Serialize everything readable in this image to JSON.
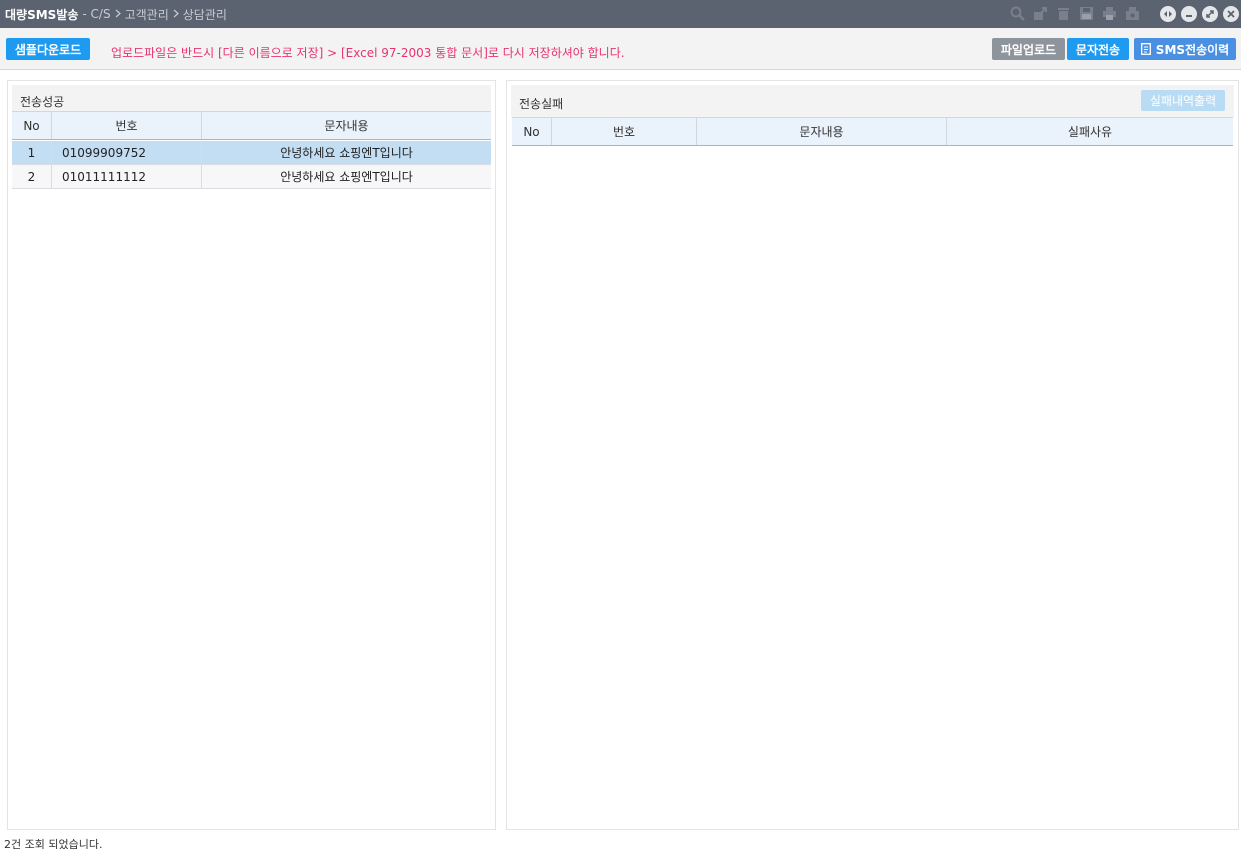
{
  "titlebar": {
    "title": "대량SMS발송",
    "crumb_lead": "- C/S",
    "crumb_1": "고객관리",
    "crumb_2": "상담관리"
  },
  "toolbar": {
    "sample_download": "샘플다운로드",
    "notice": "업로드파일은 반드시 [다른 이름으로 저장] > [Excel 97-2003 통합 문서]로 다시 저장하셔야 합니다.",
    "file_upload": "파일업로드",
    "send_message": "문자전송",
    "sms_history": "SMS전송이력"
  },
  "success_panel": {
    "title": "전송성공",
    "columns": [
      "No",
      "번호",
      "문자내용"
    ],
    "rows": [
      {
        "no": "1",
        "number": "01099909752",
        "content": "안녕하세요 쇼핑엔T입니다"
      },
      {
        "no": "2",
        "number": "01011111112",
        "content": "안녕하세요 쇼핑엔T입니다"
      }
    ]
  },
  "failure_panel": {
    "title": "전송실패",
    "export_button": "실패내역출력",
    "columns": [
      "No",
      "번호",
      "문자내용",
      "실패사유"
    ]
  },
  "status_text": "2건 조회 되었습니다.",
  "colors": {
    "titlebar": "#5b6270",
    "accent_blue": "#1e9bf0",
    "notice_red": "#e8336e",
    "selected_row": "#c3ddf3"
  },
  "icons": {
    "toolbar": [
      "search-icon",
      "share-icon",
      "delete-icon",
      "save-icon",
      "print-icon",
      "settings-icon"
    ],
    "window": [
      "fit-icon",
      "minimize-icon",
      "maximize-icon",
      "close-icon"
    ],
    "sms_history": "document-icon"
  }
}
